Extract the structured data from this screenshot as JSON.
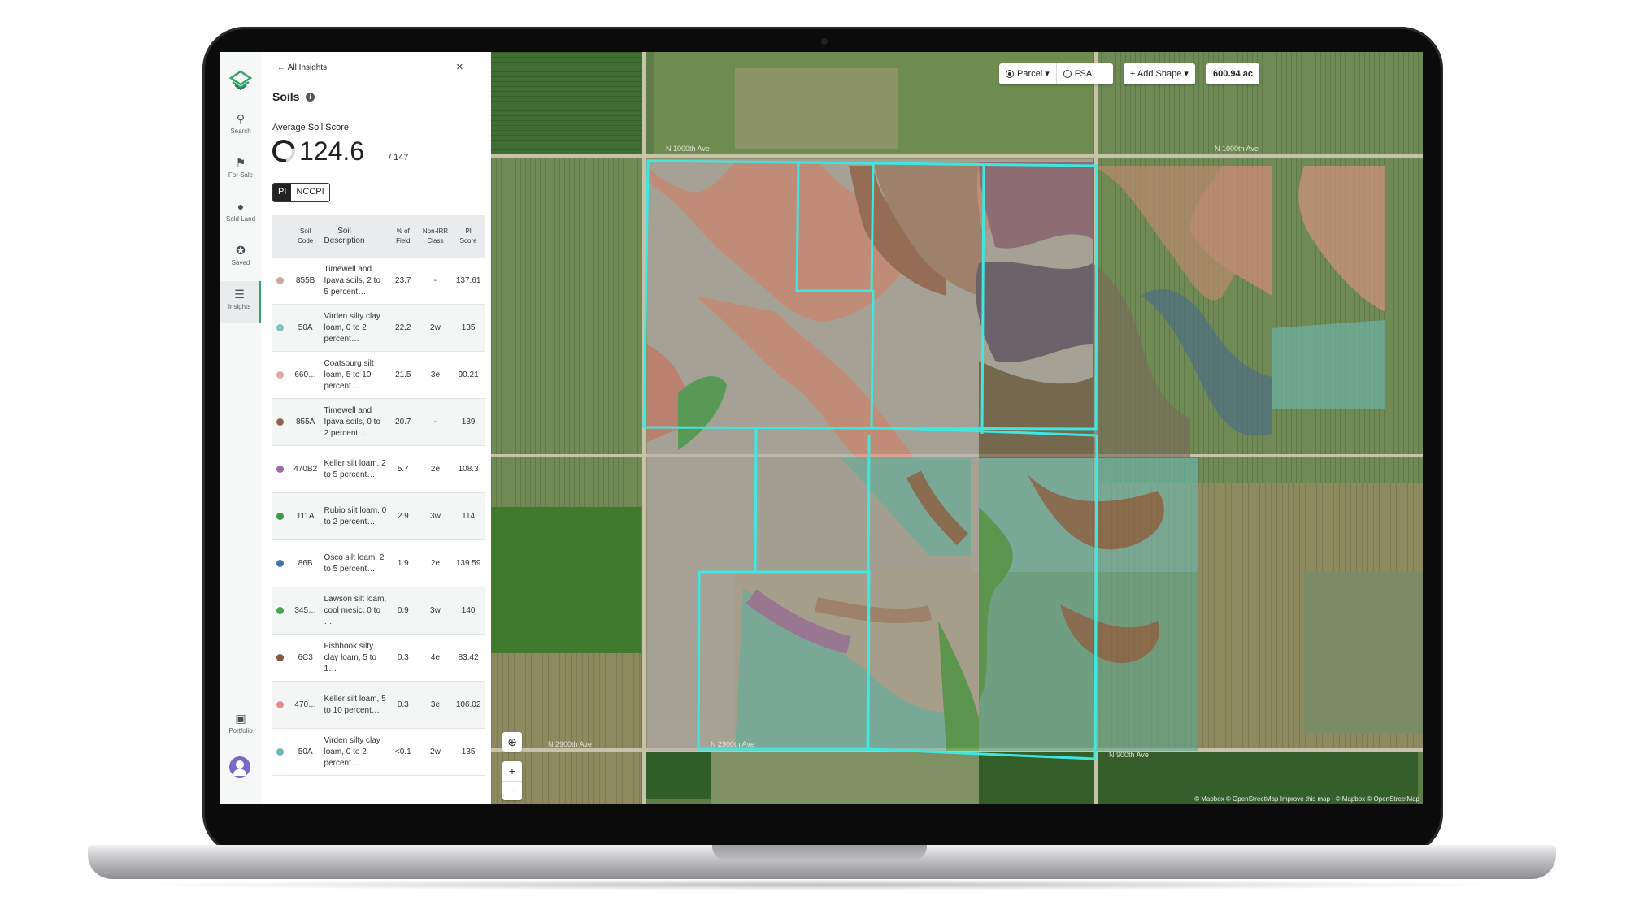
{
  "nav": {
    "items": [
      {
        "label": "Search",
        "icon": "search-icon"
      },
      {
        "label": "For Sale",
        "icon": "flag-icon"
      },
      {
        "label": "Sold Land",
        "icon": "map-pin-icon"
      },
      {
        "label": "Saved",
        "icon": "pin-icon"
      },
      {
        "label": "Insights",
        "icon": "layers-icon",
        "active": true
      },
      {
        "label": "Portfolio",
        "icon": "save-icon"
      }
    ]
  },
  "panel": {
    "back_label": "All Insights",
    "close_label": "×",
    "title": "Soils",
    "avg_label": "Average Soil Score",
    "avg_value": "124.6",
    "avg_max": "/ 147",
    "toggle": {
      "pi": "PI",
      "nccpi": "NCCPI",
      "selected": "PI"
    }
  },
  "table": {
    "headers": [
      "Soil\nCode",
      "Soil\nDescription",
      "% of\nField",
      "Non-IRR\nClass",
      "PI\nScore"
    ],
    "rows": [
      {
        "color": "#c9aaa4",
        "code": "855B",
        "desc": "Timewell and Ipava soils, 2 to 5 percent…",
        "pct": "23.7",
        "cls": "-",
        "score": "137.61"
      },
      {
        "color": "#7fc4b8",
        "code": "50A",
        "desc": "Virden silty clay loam, 0 to 2 percent…",
        "pct": "22.2",
        "cls": "2w",
        "score": "135"
      },
      {
        "color": "#e8a4a4",
        "code": "660…",
        "desc": "Coatsburg silt loam, 5 to 10 percent…",
        "pct": "21.5",
        "cls": "3e",
        "score": "90.21"
      },
      {
        "color": "#8c6454",
        "code": "855A",
        "desc": "Timewell and Ipava soils, 0 to 2 percent…",
        "pct": "20.7",
        "cls": "-",
        "score": "139"
      },
      {
        "color": "#a06aa8",
        "code": "470B2",
        "desc": "Keller silt loam, 2 to 5 percent…",
        "pct": "5.7",
        "cls": "2e",
        "score": "108.3"
      },
      {
        "color": "#3e9a3e",
        "code": "111A",
        "desc": "Rubio silt loam, 0 to 2 percent…",
        "pct": "2.9",
        "cls": "3w",
        "score": "114"
      },
      {
        "color": "#3f77a8",
        "code": "86B",
        "desc": "Osco silt loam, 2 to 5 percent…",
        "pct": "1.9",
        "cls": "2e",
        "score": "139.59"
      },
      {
        "color": "#4aa64a",
        "code": "345…",
        "desc": "Lawson silt loam, cool mesic, 0 to …",
        "pct": "0.9",
        "cls": "3w",
        "score": "140"
      },
      {
        "color": "#8a5a42",
        "code": "6C3",
        "desc": "Fishhook silty clay loam, 5 to 1…",
        "pct": "0.3",
        "cls": "4e",
        "score": "83.42"
      },
      {
        "color": "#e88a94",
        "code": "470…",
        "desc": "Keller silt loam, 5 to 10 percent…",
        "pct": "0.3",
        "cls": "3e",
        "score": "106.02"
      },
      {
        "color": "#6fbab2",
        "code": "50A",
        "desc": "Virden silty clay loam, 0 to 2 percent…",
        "pct": "<0.1",
        "cls": "2w",
        "score": "135"
      }
    ]
  },
  "map": {
    "parcel_label": "Parcel",
    "fsa_label": "FSA",
    "add_shape_label": "Add Shape",
    "acres": "600.94 ac",
    "zoom_in": "+",
    "zoom_out": "−",
    "attribution": "© Mapbox © OpenStreetMap Improve this map | © Mapbox © OpenStreetMap",
    "roads": [
      "N 1000th Ave",
      "N 1000th Ave",
      "N 2900th Ave",
      "N 2900th Ave",
      "N 900th Ave"
    ],
    "outline_color": "#3ee8e0"
  }
}
